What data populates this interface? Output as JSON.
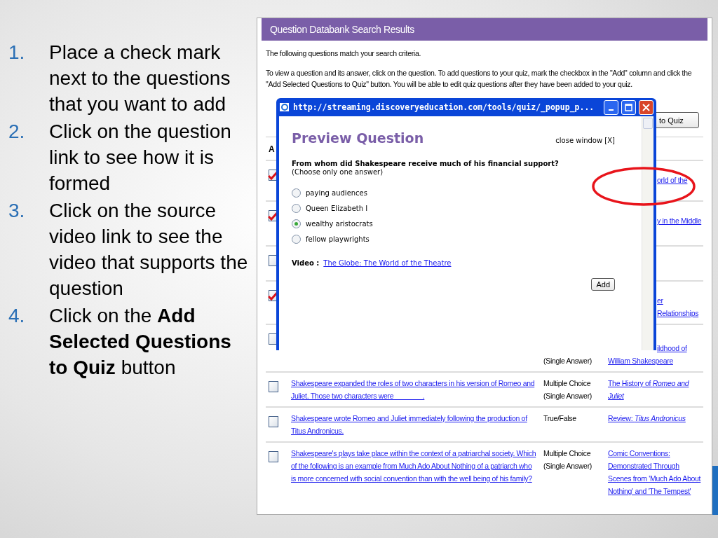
{
  "steps": [
    {
      "number": "1.",
      "text": "Place a check mark next to the questions that you want to add"
    },
    {
      "number": "2.",
      "text": "Click on the question link to see how it is formed"
    },
    {
      "number": "3.",
      "text": "Click on the source video link to see the video that supports the question"
    },
    {
      "number": "4.",
      "text": "Click on the **Add Selected Questions to Quiz** button"
    }
  ],
  "results": {
    "title": "Question Databank Search Results",
    "intro": "The following questions match your search criteria.",
    "instructions": "To view a question and its answer, click on the question. To add questions to your quiz, mark the checkbox in the \"Add\" column and click the \"Add Selected Questions to Quiz\" button. You will be able to edit quiz questions after they have been added to your quiz.",
    "button": "to Quiz",
    "header": "A",
    "rows": [
      {
        "kind": "covered",
        "checked": true,
        "source": "orld of the"
      },
      {
        "kind": "covered",
        "checked": true,
        "source": "y in the Middle"
      },
      {
        "kind": "covered",
        "checked": false,
        "source": ""
      },
      {
        "kind": "covered",
        "checked": true,
        "source": "er Relationships"
      },
      {
        "kind": "partly_covered",
        "checked": false,
        "type": "(Single Answer)",
        "source": "ildhood of",
        "source_tail": "William Shakespeare"
      },
      {
        "kind": "full",
        "checked": false,
        "question": "Shakespeare expanded the roles of two characters in his version of Romeo and Juliet. Those two characters were _______.",
        "type": "Multiple Choice (Single Answer)",
        "source": "The History of *Romeo and Juliet*"
      },
      {
        "kind": "full",
        "checked": false,
        "question": "Shakespeare wrote Romeo and Juliet immediately following the production of Titus Andronicus.",
        "type": "True/False",
        "source": "Review: *Titus Andronicus*"
      },
      {
        "kind": "full",
        "checked": false,
        "question": "Shakespeare's plays take place within the context of a patriarchal society. Which of the following is an example from Much Ado About Nothing of a patriarch who is more concerned with social convention than with the well being of his family?",
        "type": "Multiple Choice (Single Answer)",
        "source": "Comic Conventions: Demonstrated Through Scenes from 'Much Ado About Nothing' and 'The Tempest'"
      }
    ]
  },
  "popup": {
    "title": "http://streaming.discoveryeducation.com/tools/quiz/_popup_p...",
    "heading": "Preview Question",
    "close": "close window [X]",
    "question": "From whom did Shakespeare receive much of his financial support?",
    "hint": "(Choose only one answer)",
    "options": [
      {
        "label": "paying audiences",
        "selected": false
      },
      {
        "label": "Queen Elizabeth I",
        "selected": false
      },
      {
        "label": "wealthy aristocrats",
        "selected": true
      },
      {
        "label": "fellow playwrights",
        "selected": false
      }
    ],
    "video_label": "Video :",
    "video_link": "The Globe: The World of the Theatre",
    "add": "Add"
  }
}
